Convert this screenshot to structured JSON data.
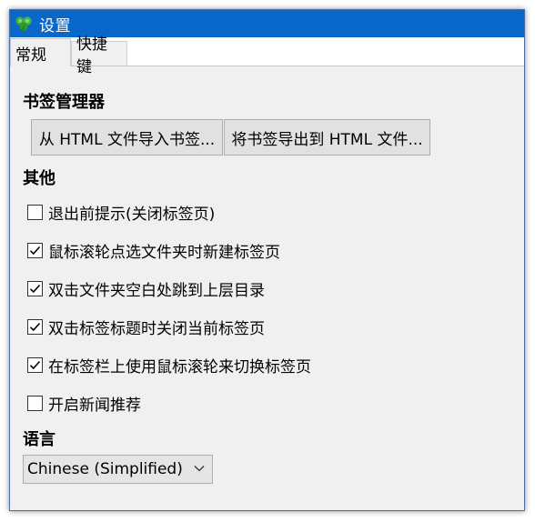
{
  "window": {
    "title": "设置",
    "title_icon": "clover-icon",
    "accent_color": "#0867c9"
  },
  "tabs": [
    {
      "label": "常规",
      "active": true
    },
    {
      "label": "快捷键",
      "active": false
    }
  ],
  "bookmark_manager": {
    "heading": "书签管理器",
    "import_button": "从 HTML 文件导入书签...",
    "export_button": "将书签导出到 HTML 文件..."
  },
  "other": {
    "heading": "其他",
    "options": [
      {
        "label": "退出前提示(关闭标签页)",
        "checked": false
      },
      {
        "label": "鼠标滚轮点选文件夹时新建标签页",
        "checked": true
      },
      {
        "label": "双击文件夹空白处跳到上层目录",
        "checked": true
      },
      {
        "label": "双击标签标题时关闭当前标签页",
        "checked": true
      },
      {
        "label": "在标签栏上使用鼠标滚轮来切换标签页",
        "checked": true
      },
      {
        "label": "开启新闻推荐",
        "checked": false
      }
    ]
  },
  "language": {
    "heading": "语言",
    "selected": "Chinese (Simplified)"
  }
}
